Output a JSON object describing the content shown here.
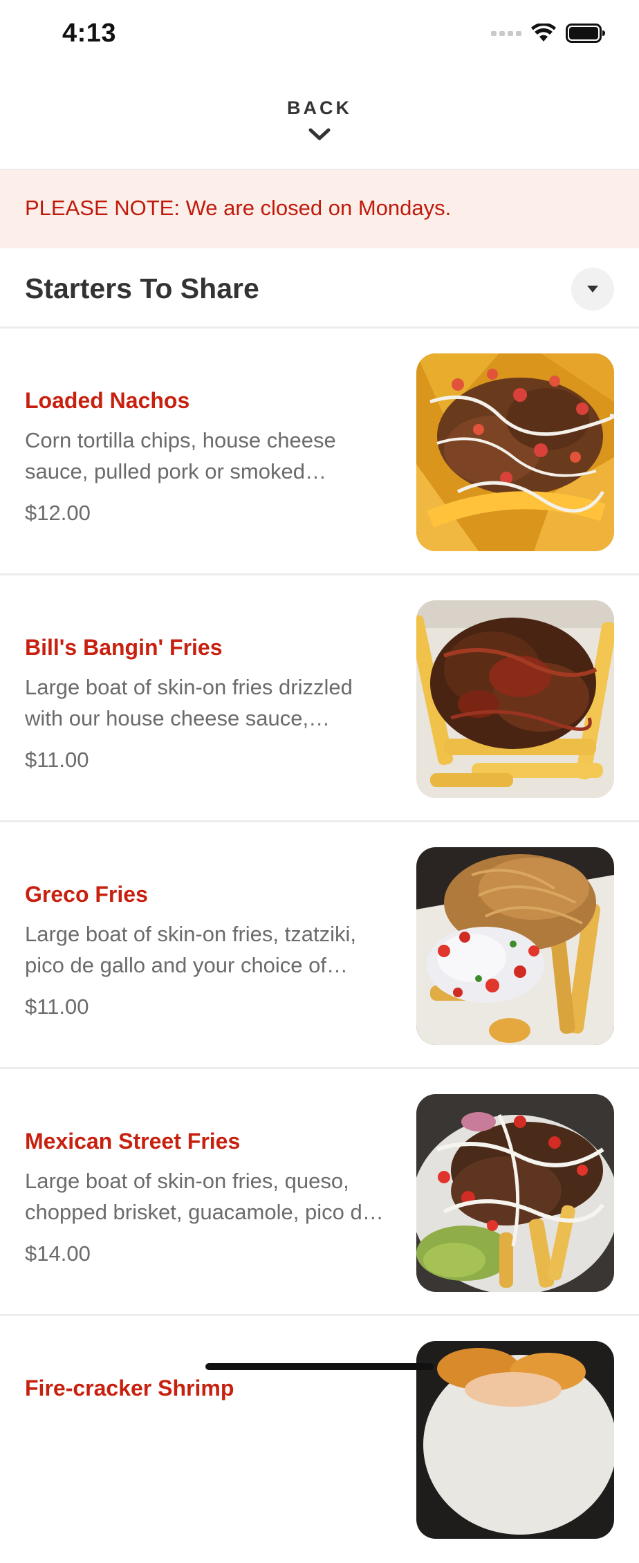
{
  "status_bar": {
    "time": "4:13",
    "icons": [
      "cellular-signal-icon",
      "wifi-icon",
      "battery-icon"
    ]
  },
  "header": {
    "back_label": "BACK",
    "back_icon": "chevron-down-icon"
  },
  "notice": {
    "text": "PLEASE NOTE: We are closed on Mondays."
  },
  "section": {
    "title": "Starters To Share",
    "toggle_icon": "triangle-down-icon"
  },
  "colors": {
    "item_name": "#c8200f",
    "notice_text": "#c01a0d",
    "notice_background": "#fcefea"
  },
  "items": [
    {
      "name": "Loaded Nachos",
      "description": "Corn tortilla chips, house cheese sauce, pulled pork or smoked chicken...",
      "price": "$12.00"
    },
    {
      "name": "Bill's Bangin' Fries",
      "description": "Large boat of skin-on fries drizzled with our house cheese sauce, topped...",
      "price": "$11.00"
    },
    {
      "name": "Greco Fries",
      "description": "Large boat of skin-on fries,  tzatziki, pico de gallo and your choice of protein...",
      "price": "$11.00"
    },
    {
      "name": "Mexican Street Fries",
      "description": "Large boat of skin-on fries, queso, chopped brisket, guacamole, pico de gallo...",
      "price": "$14.00"
    },
    {
      "name": "Fire-cracker Shrimp",
      "description": "",
      "price": ""
    }
  ]
}
